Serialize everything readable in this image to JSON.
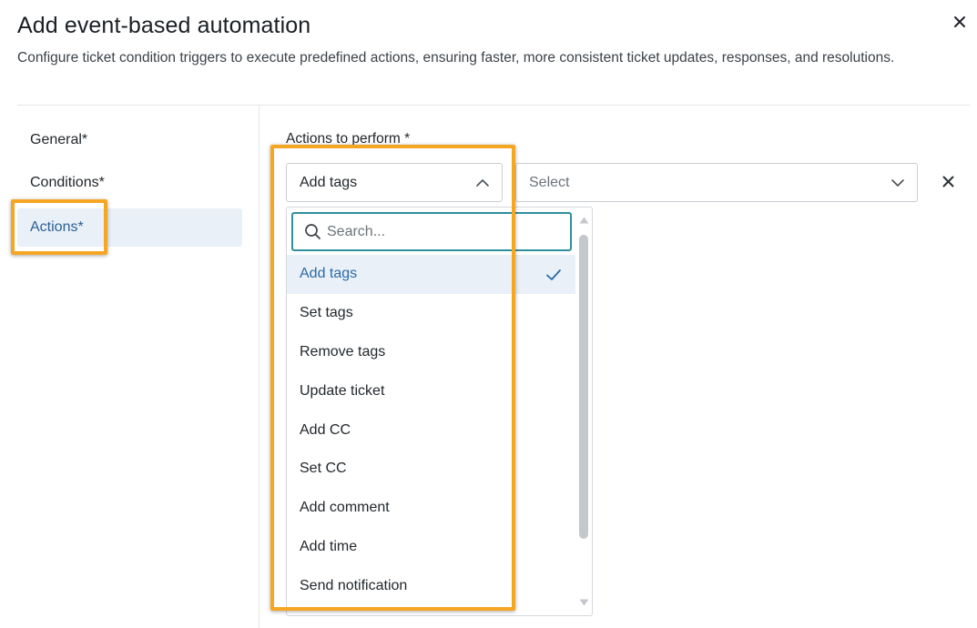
{
  "modal": {
    "title": "Add event-based automation",
    "subtitle": "Configure ticket condition triggers to execute predefined actions, ensuring faster, more consistent ticket updates, responses, and resolutions.",
    "close_icon": "close-icon"
  },
  "sidebar": {
    "items": [
      {
        "label": "General*",
        "active": false
      },
      {
        "label": "Conditions*",
        "active": false
      },
      {
        "label": "Actions*",
        "active": true
      }
    ]
  },
  "actions": {
    "label": "Actions to perform *",
    "action_select": {
      "value": "Add tags",
      "icon": "chevron-up-icon"
    },
    "value_select": {
      "placeholder": "Select",
      "icon": "chevron-down-icon"
    },
    "remove_icon": "close-icon"
  },
  "dropdown": {
    "search_placeholder": "Search...",
    "search_icon": "search-icon",
    "options": [
      {
        "label": "Add tags",
        "selected": true
      },
      {
        "label": "Set tags",
        "selected": false
      },
      {
        "label": "Remove tags",
        "selected": false
      },
      {
        "label": "Update ticket",
        "selected": false
      },
      {
        "label": "Add CC",
        "selected": false
      },
      {
        "label": "Set CC",
        "selected": false
      },
      {
        "label": "Add comment",
        "selected": false
      },
      {
        "label": "Add time",
        "selected": false
      },
      {
        "label": "Send notification",
        "selected": false
      }
    ],
    "selected_icon": "check-icon"
  },
  "colors": {
    "accent": "#2b6aa6",
    "active_bg": "#e9f0f7",
    "highlight": "#f5a623",
    "search_border": "#2f8f9d"
  }
}
